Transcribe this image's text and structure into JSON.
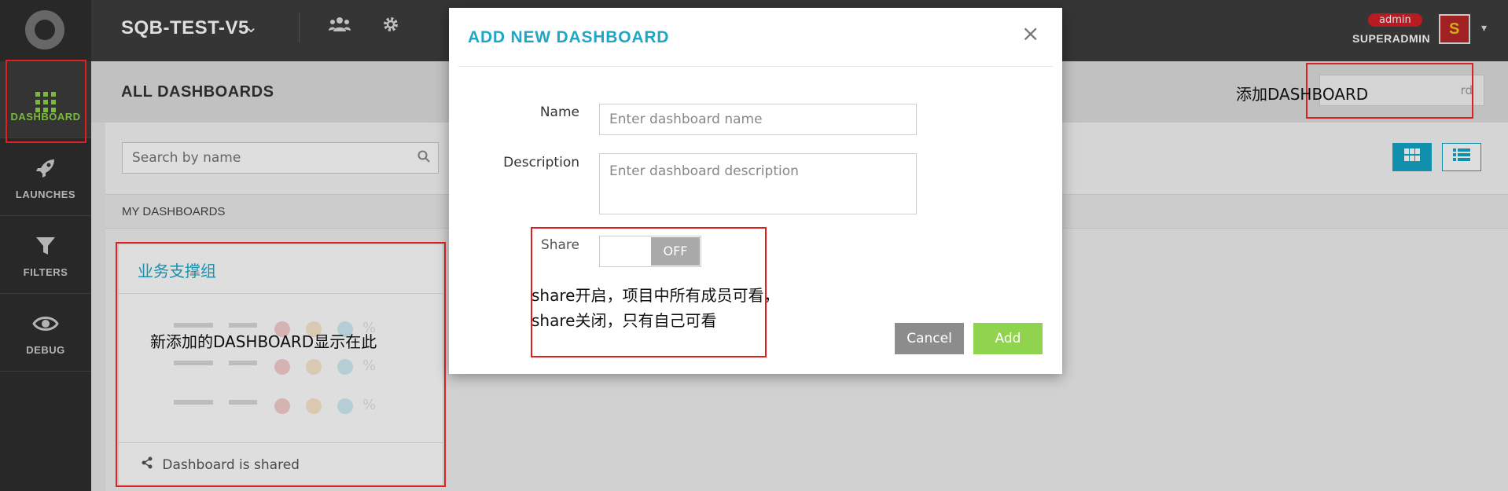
{
  "sidebar": {
    "logo_icon": "aperture-logo",
    "items": [
      {
        "label": "DASHBOARD",
        "icon": "grid-icon",
        "active": true
      },
      {
        "label": "LAUNCHES",
        "icon": "rocket-icon",
        "active": false
      },
      {
        "label": "FILTERS",
        "icon": "filter-icon",
        "active": false
      },
      {
        "label": "DEBUG",
        "icon": "eye-icon",
        "active": false
      }
    ]
  },
  "topbar": {
    "project": "SQB-TEST-V5",
    "role_badge": "admin",
    "username": "SUPERADMIN",
    "icons": [
      "members-icon",
      "settings-icon"
    ]
  },
  "page": {
    "title": "ALL DASHBOARDS",
    "add_button": "rd",
    "add_annotation": "添加DASHBOARD"
  },
  "search": {
    "placeholder": "Search by name"
  },
  "section": {
    "title": "MY DASHBOARDS"
  },
  "card": {
    "title": "业务支撑组",
    "annotation": "新添加的DASHBOARD显示在此",
    "shared_text": "Dashboard is shared",
    "preview_pct": "%"
  },
  "modal": {
    "title": "ADD NEW DASHBOARD",
    "name_label": "Name",
    "name_placeholder": "Enter dashboard name",
    "description_label": "Description",
    "description_placeholder": "Enter dashboard description",
    "share_label": "Share",
    "share_state": "OFF",
    "share_note_line1": "share开启，项目中所有成员可看，",
    "share_note_line2": "share关闭，只有自己可看",
    "cancel": "Cancel",
    "add": "Add"
  },
  "colors": {
    "accent": "#1fa6c7",
    "green": "#8fd34f",
    "sidebar": "#2f2f2f",
    "topbar": "#3d3d3d",
    "annotation_red": "#e02020",
    "badge_red": "#d42026"
  }
}
